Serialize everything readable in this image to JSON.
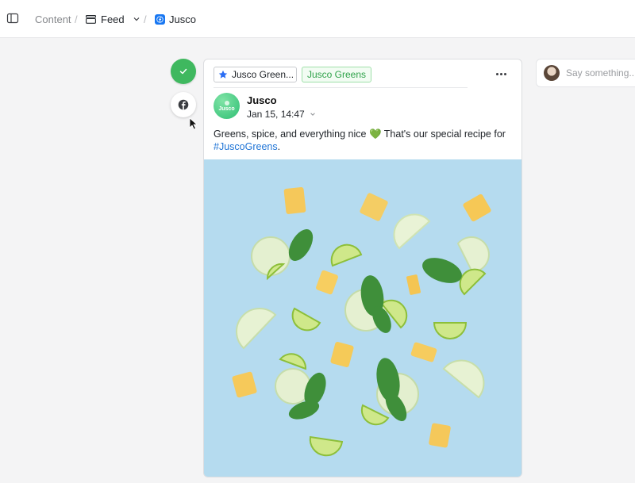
{
  "breadcrumb": {
    "content": "Content",
    "feed": "Feed",
    "page": "Jusco",
    "separator": "/"
  },
  "actions": {
    "approve_icon": "check-icon",
    "network_icon": "facebook-icon",
    "approve_color": "#3fb85f"
  },
  "post": {
    "campaign_tag": "Jusco Green...",
    "label_tag": "Jusco Greens",
    "author": "Jusco",
    "avatar_text": "Jusco",
    "timestamp": "Jan 15, 14:47",
    "text_before": "Greens, spice, and everything nice ",
    "emoji": "💚",
    "text_after": " That's our special recipe for",
    "hashtag": "#JuscoGreens",
    "text_end": ".",
    "hashtag_color": "#1f74d6",
    "label_color": "#2fa24a"
  },
  "comment": {
    "placeholder": "Say something..."
  }
}
